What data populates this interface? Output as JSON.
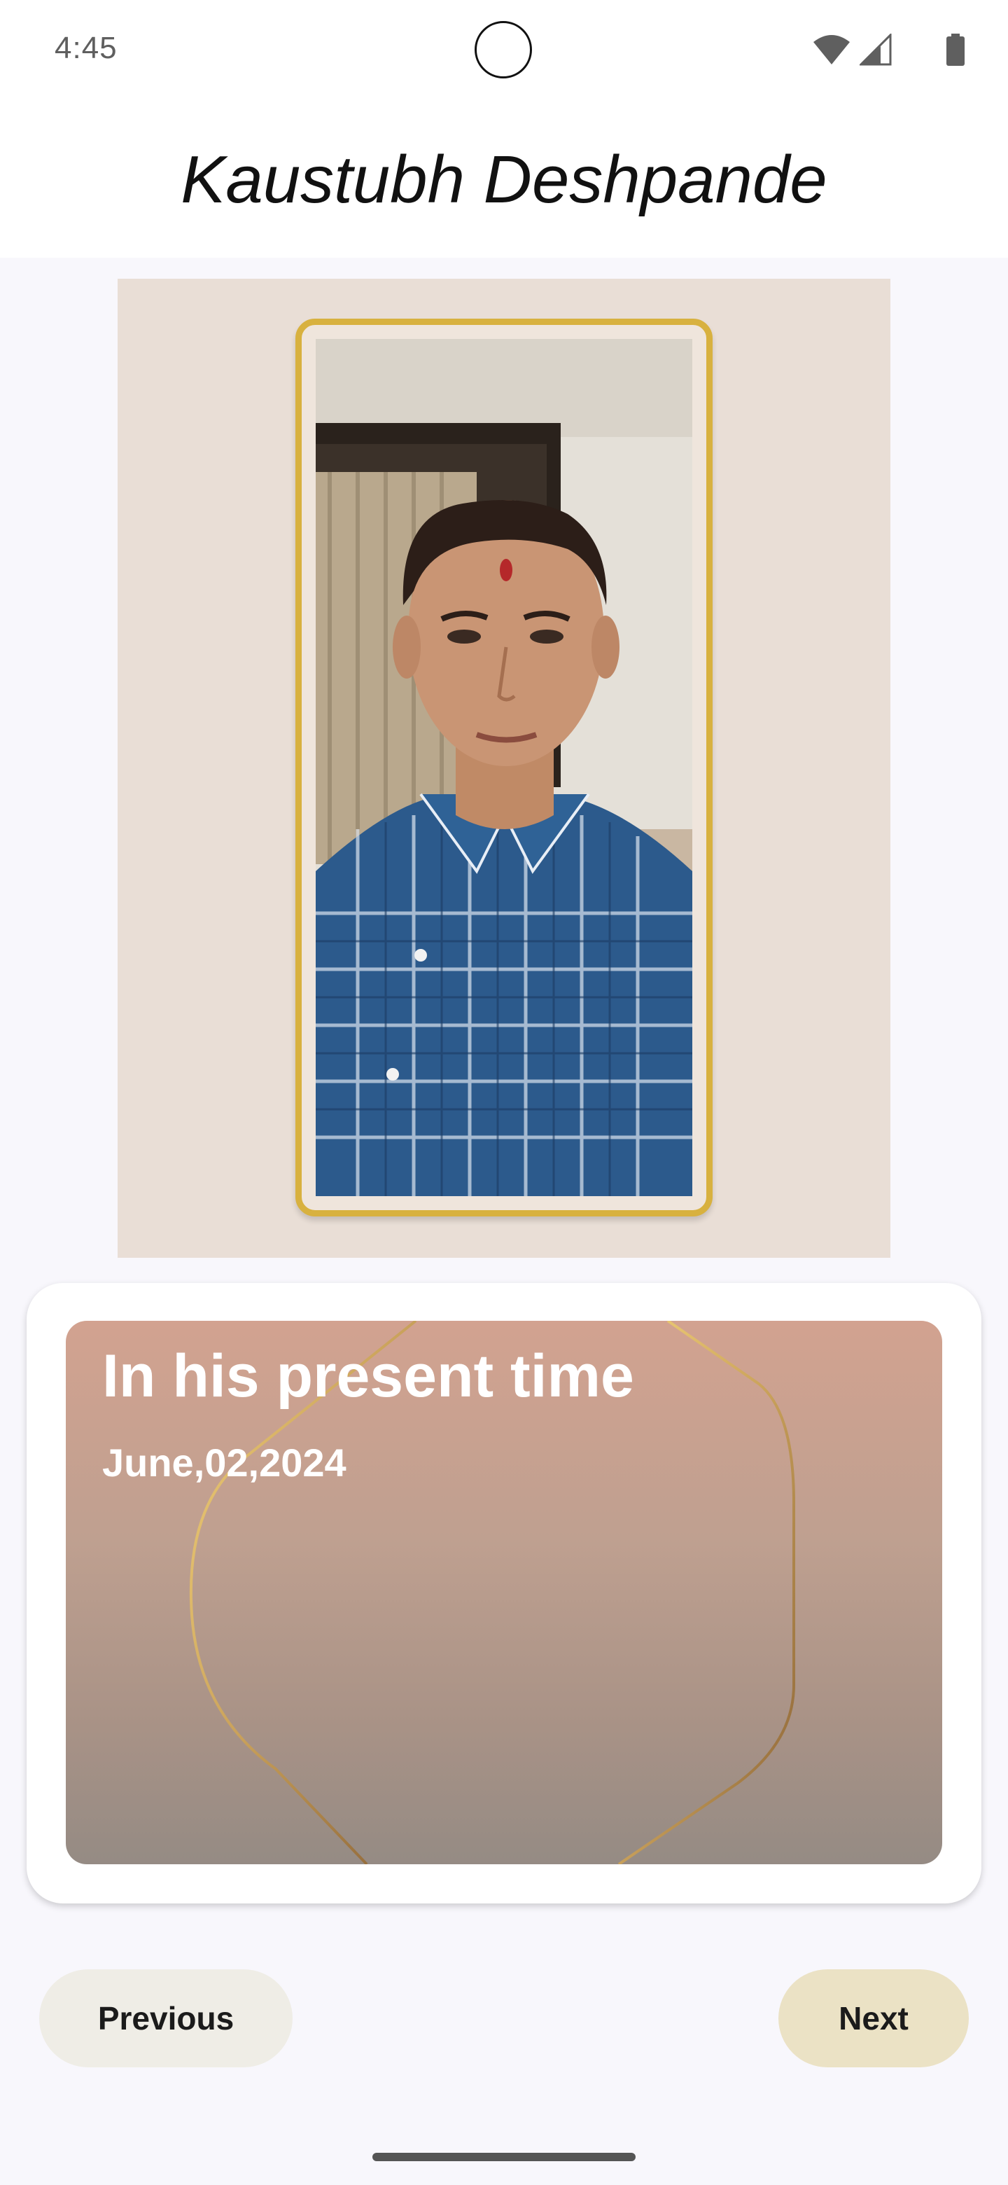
{
  "status_bar": {
    "time": "4:45",
    "icons": [
      "wifi-icon",
      "cellular-signal-icon",
      "battery-icon"
    ]
  },
  "header": {
    "title": "Kaustubh Deshpande"
  },
  "photo": {
    "frame_color": "#d8b13f",
    "background_color": "#e9ded6"
  },
  "info_card": {
    "title": "In his present time",
    "date": "June,02,2024"
  },
  "navigation": {
    "previous_label": "Previous",
    "next_label": "Next"
  },
  "colors": {
    "accent_gold": "#d8b13f",
    "next_button_bg": "#ebe2c5",
    "previous_button_bg": "#efede6"
  }
}
